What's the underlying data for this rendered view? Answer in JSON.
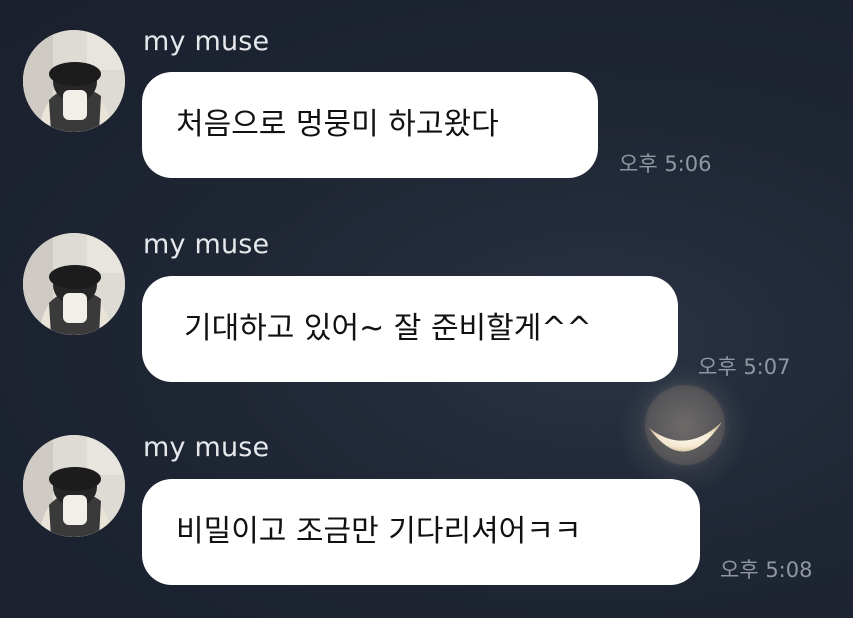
{
  "chat": {
    "messages": [
      {
        "sender": "my muse",
        "text": "처음으로 멍뭉미 하고왔다",
        "time": "오후 5:06"
      },
      {
        "sender": "my muse",
        "text": "기대하고 있어~ 잘 준비할게^^",
        "time": "오후 5:07"
      },
      {
        "sender": "my muse",
        "text": "비밀이고 조금만 기다리셔어ㅋㅋ",
        "time": "오후 5:08"
      }
    ]
  },
  "colors": {
    "background": "#1f2634",
    "bubble": "#ffffff",
    "sender_name": "#e6e8ec",
    "timestamp": "#9097a3"
  },
  "icons": {
    "avatar": "profile-photo",
    "background_decoration": "crescent-moon"
  }
}
